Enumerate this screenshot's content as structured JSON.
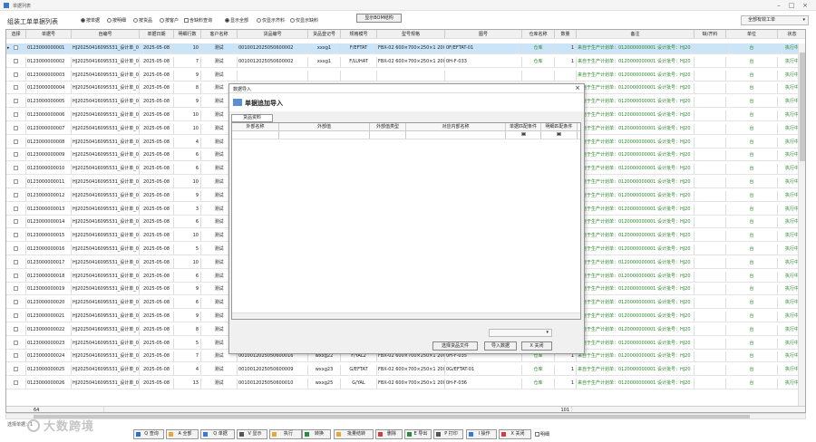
{
  "window": {
    "title": "单据列表"
  },
  "header": {
    "title": "组装工单单据列表",
    "view_options": [
      {
        "label": "按单据",
        "on": true
      },
      {
        "label": "按明细",
        "on": false
      },
      {
        "label": "按货品",
        "on": false
      },
      {
        "label": "按客户",
        "on": false
      }
    ],
    "material_query": "含缺料查询",
    "display_options": [
      {
        "label": "显示全部",
        "on": true
      },
      {
        "label": "仅显示齐料",
        "on": false
      },
      {
        "label": "仅显示缺料",
        "on": false
      }
    ],
    "bom_button": "显示BOM结构",
    "filter_dropdown": "全部有效工单"
  },
  "grid": {
    "columns": [
      "选择",
      "单据号",
      "自编号",
      "单据日期",
      "明细行数",
      "客户名称",
      "货品编号",
      "货品登记号",
      "规格模号",
      "型号规格",
      "图号",
      "仓库名称",
      "数量",
      "备注",
      "缺/齐料",
      "单位",
      "状态"
    ],
    "rows": [
      {
        "id": "0123000000001",
        "code": "HJ20250416095531_设计单_001",
        "date": "2025-05-08",
        "lines": "10",
        "cust": "测试",
        "prod": "0010012025050600002",
        "reg": "xxxg1",
        "mold": "F/EFTAT",
        "spec": "FBX-02 600×700×250×1 200",
        "drawing": "0F/EFTAT-01",
        "wh": "仓库",
        "qty": "1",
        "note": "来自于生产计划单：0120000000001 设计批号：HJ20",
        "shortage": "",
        "unit": "台",
        "status": "执行中"
      },
      {
        "id": "0123000000002",
        "code": "HJ20250416095531_设计单_001",
        "date": "2025-05-08",
        "lines": "7",
        "cust": "测试",
        "prod": "0010012025050600002",
        "reg": "xxxg1",
        "mold": "F/LUHAT",
        "spec": "FBX-02 600×700×250×1 200",
        "drawing": "0H-F-033",
        "wh": "仓库",
        "qty": "1",
        "note": "来自于生产计划单：0120000000001 设计批号：HJ20",
        "shortage": "",
        "unit": "台",
        "status": "执行中"
      },
      {
        "id": "0123000000003",
        "code": "HJ20250416095531_设计单_001",
        "date": "2025-05-08",
        "lines": "9",
        "cust": "测试",
        "prod": "",
        "reg": "",
        "mold": "",
        "spec": "",
        "drawing": "",
        "wh": "",
        "qty": "",
        "note": "来自于生产计划单：0120000000001 设计批号：HJ20",
        "shortage": "",
        "unit": "台",
        "status": "执行中"
      },
      {
        "id": "0123000000004",
        "code": "HJ20250416095531_设计单_001",
        "date": "2025-05-08",
        "lines": "8",
        "cust": "测试",
        "prod": "",
        "reg": "",
        "mold": "",
        "spec": "",
        "drawing": "",
        "wh": "",
        "qty": "",
        "note": "来自于生产计划单：0120000000001 设计批号：HJ20",
        "shortage": "",
        "unit": "台",
        "status": "执行中"
      },
      {
        "id": "0123000000005",
        "code": "HJ20250416095531_设计单_001",
        "date": "2025-05-08",
        "lines": "9",
        "cust": "测试",
        "prod": "",
        "reg": "",
        "mold": "",
        "spec": "",
        "drawing": "",
        "wh": "",
        "qty": "",
        "note": "来自于生产计划单：0120000000001 设计批号：HJ20",
        "shortage": "",
        "unit": "台",
        "status": "执行中"
      },
      {
        "id": "0123000000006",
        "code": "HJ20250416095531_设计单_001",
        "date": "2025-05-08",
        "lines": "10",
        "cust": "测试",
        "prod": "",
        "reg": "",
        "mold": "",
        "spec": "",
        "drawing": "",
        "wh": "",
        "qty": "",
        "note": "来自于生产计划单：0120000000001 设计批号：HJ20",
        "shortage": "",
        "unit": "台",
        "status": "执行中"
      },
      {
        "id": "0123000000007",
        "code": "HJ20250416095531_设计单_001",
        "date": "2025-05-08",
        "lines": "10",
        "cust": "测试",
        "prod": "",
        "reg": "",
        "mold": "",
        "spec": "",
        "drawing": "",
        "wh": "",
        "qty": "",
        "note": "来自于生产计划单：0120000000001 设计批号：HJ20",
        "shortage": "",
        "unit": "台",
        "status": "执行中"
      },
      {
        "id": "0123000000008",
        "code": "HJ20250416095531_设计单_001",
        "date": "2025-05-08",
        "lines": "4",
        "cust": "测试",
        "prod": "",
        "reg": "",
        "mold": "",
        "spec": "",
        "drawing": "",
        "wh": "",
        "qty": "",
        "note": "来自于生产计划单：0120000000001 设计批号：HJ20",
        "shortage": "",
        "unit": "台",
        "status": "执行中"
      },
      {
        "id": "0123000000009",
        "code": "HJ20250416095531_设计单_001",
        "date": "2025-05-08",
        "lines": "6",
        "cust": "测试",
        "prod": "",
        "reg": "",
        "mold": "",
        "spec": "",
        "drawing": "",
        "wh": "",
        "qty": "",
        "note": "来自于生产计划单：0120000000001 设计批号：HJ20",
        "shortage": "",
        "unit": "台",
        "status": "执行中"
      },
      {
        "id": "0123000000010",
        "code": "HJ20250416095531_设计单_001",
        "date": "2025-05-08",
        "lines": "6",
        "cust": "测试",
        "prod": "",
        "reg": "",
        "mold": "",
        "spec": "",
        "drawing": "",
        "wh": "",
        "qty": "",
        "note": "来自于生产计划单：0120000000001 设计批号：HJ20",
        "shortage": "",
        "unit": "台",
        "status": "执行中"
      },
      {
        "id": "0123000000011",
        "code": "HJ20250416095531_设计单_001",
        "date": "2025-05-08",
        "lines": "10",
        "cust": "测试",
        "prod": "",
        "reg": "",
        "mold": "",
        "spec": "",
        "drawing": "",
        "wh": "",
        "qty": "",
        "note": "来自于生产计划单：0120000000001 设计批号：HJ20",
        "shortage": "",
        "unit": "台",
        "status": "执行中"
      },
      {
        "id": "0123000000012",
        "code": "HJ20250416095531_设计单_001",
        "date": "2025-05-08",
        "lines": "9",
        "cust": "测试",
        "prod": "",
        "reg": "",
        "mold": "",
        "spec": "",
        "drawing": "",
        "wh": "",
        "qty": "",
        "note": "来自于生产计划单：0120000000001 设计批号：HJ20",
        "shortage": "",
        "unit": "台",
        "status": "执行中"
      },
      {
        "id": "0123000000013",
        "code": "HJ20250416095531_设计单_001",
        "date": "2025-05-08",
        "lines": "3",
        "cust": "测试",
        "prod": "",
        "reg": "",
        "mold": "",
        "spec": "",
        "drawing": "",
        "wh": "",
        "qty": "",
        "note": "来自于生产计划单：0120000000001 设计批号：HJ20",
        "shortage": "",
        "unit": "台",
        "status": "执行中"
      },
      {
        "id": "0123000000014",
        "code": "HJ20250416095531_设计单_001",
        "date": "2025-05-08",
        "lines": "6",
        "cust": "测试",
        "prod": "",
        "reg": "",
        "mold": "",
        "spec": "",
        "drawing": "",
        "wh": "",
        "qty": "",
        "note": "来自于生产计划单：0120000000001 设计批号：HJ20",
        "shortage": "",
        "unit": "台",
        "status": "执行中"
      },
      {
        "id": "0123000000015",
        "code": "HJ20250416095531_设计单_001",
        "date": "2025-05-08",
        "lines": "10",
        "cust": "测试",
        "prod": "",
        "reg": "",
        "mold": "",
        "spec": "",
        "drawing": "",
        "wh": "",
        "qty": "",
        "note": "来自于生产计划单：0120000000001 设计批号：HJ20",
        "shortage": "",
        "unit": "台",
        "status": "执行中"
      },
      {
        "id": "0123000000016",
        "code": "HJ20250416095531_设计单_001",
        "date": "2025-05-08",
        "lines": "5",
        "cust": "测试",
        "prod": "",
        "reg": "",
        "mold": "",
        "spec": "",
        "drawing": "",
        "wh": "",
        "qty": "",
        "note": "来自于生产计划单：0120000000001 设计批号：HJ20",
        "shortage": "",
        "unit": "台",
        "status": "执行中"
      },
      {
        "id": "0123000000017",
        "code": "HJ20250416095531_设计单_001",
        "date": "2025-05-08",
        "lines": "10",
        "cust": "测试",
        "prod": "",
        "reg": "",
        "mold": "",
        "spec": "",
        "drawing": "",
        "wh": "",
        "qty": "",
        "note": "来自于生产计划单：0120000000001 设计批号：HJ20",
        "shortage": "",
        "unit": "台",
        "status": "执行中"
      },
      {
        "id": "0123000000018",
        "code": "HJ20250416095531_设计单_001",
        "date": "2025-05-08",
        "lines": "6",
        "cust": "测试",
        "prod": "",
        "reg": "",
        "mold": "",
        "spec": "",
        "drawing": "",
        "wh": "",
        "qty": "",
        "note": "来自于生产计划单：0120000000001 设计批号：HJ20",
        "shortage": "",
        "unit": "台",
        "status": "执行中"
      },
      {
        "id": "0123000000019",
        "code": "HJ20250416095531_设计单_001",
        "date": "2025-05-08",
        "lines": "9",
        "cust": "测试",
        "prod": "",
        "reg": "",
        "mold": "",
        "spec": "",
        "drawing": "",
        "wh": "",
        "qty": "",
        "note": "来自于生产计划单：0120000000001 设计批号：HJ20",
        "shortage": "",
        "unit": "台",
        "status": "执行中"
      },
      {
        "id": "0123000000020",
        "code": "HJ20250416095531_设计单_001",
        "date": "2025-05-08",
        "lines": "6",
        "cust": "测试",
        "prod": "",
        "reg": "",
        "mold": "",
        "spec": "",
        "drawing": "",
        "wh": "",
        "qty": "",
        "note": "来自于生产计划单：0120000000001 设计批号：HJ20",
        "shortage": "",
        "unit": "台",
        "status": "执行中"
      },
      {
        "id": "0123000000021",
        "code": "HJ20250416095531_设计单_001",
        "date": "2025-05-08",
        "lines": "9",
        "cust": "测试",
        "prod": "",
        "reg": "",
        "mold": "",
        "spec": "",
        "drawing": "",
        "wh": "",
        "qty": "",
        "note": "来自于生产计划单：0120000000001 设计批号：HJ20",
        "shortage": "",
        "unit": "台",
        "status": "执行中"
      },
      {
        "id": "0123000000022",
        "code": "HJ20250416095531_设计单_001",
        "date": "2025-05-08",
        "lines": "8",
        "cust": "测试",
        "prod": "",
        "reg": "",
        "mold": "",
        "spec": "",
        "drawing": "",
        "wh": "",
        "qty": "",
        "note": "来自于生产计划单：0120000000001 设计批号：HJ20",
        "shortage": "",
        "unit": "台",
        "status": "执行中"
      },
      {
        "id": "0123000000023",
        "code": "HJ20250416095531_设计单_001",
        "date": "2025-05-08",
        "lines": "5",
        "cust": "测试",
        "prod": "",
        "reg": "",
        "mold": "",
        "spec": "",
        "drawing": "",
        "wh": "",
        "qty": "",
        "note": "来自于生产计划单：0120000000001 设计批号：HJ20",
        "shortage": "",
        "unit": "台",
        "status": "执行中"
      },
      {
        "id": "0123000000024",
        "code": "HJ20250416095531_设计单_001",
        "date": "2025-05-08",
        "lines": "7",
        "cust": "测试",
        "prod": "0010012025050600016",
        "reg": "wxxg22",
        "mold": "F/YAL2",
        "spec": "FBX-02 600×700×250×1 200",
        "drawing": "0H-F-035",
        "wh": "仓库",
        "qty": "1",
        "note": "来自于生产计划单：0120000000001 设计批号：HJ20",
        "shortage": "",
        "unit": "台",
        "status": "执行中"
      },
      {
        "id": "0123000000025",
        "code": "HJ20250416095531_设计单_001",
        "date": "2025-05-08",
        "lines": "4",
        "cust": "测试",
        "prod": "0010012025050600009",
        "reg": "wxxg23",
        "mold": "G/EFTAT",
        "spec": "FBX-02 600×700×250×1 200",
        "drawing": "0G/EFTAT-01",
        "wh": "仓库",
        "qty": "1",
        "note": "来自于生产计划单：0120000000001 设计批号：HJ20",
        "shortage": "",
        "unit": "台",
        "status": "执行中"
      },
      {
        "id": "0123000000026",
        "code": "HJ20250416095531_设计单_001",
        "date": "2025-05-08",
        "lines": "13",
        "cust": "测试",
        "prod": "0010012025050600010",
        "reg": "wxxg25",
        "mold": "G/YAL",
        "spec": "FBX-02 600×700×250×1 200",
        "drawing": "0H-F-036",
        "wh": "仓库",
        "qty": "1",
        "note": "来自于生产计划单：0120000000001 设计批号：HJ20",
        "shortage": "",
        "unit": "台",
        "status": "执行中"
      }
    ],
    "footer_count": "64",
    "footer_qty": "101"
  },
  "status": {
    "text": "选择单据：1"
  },
  "toolbar": [
    {
      "label": "Q 查询",
      "color": "#2b6fd1"
    },
    {
      "label": "A 全部",
      "color": "#e8a53a"
    },
    {
      "label": "Q 单据",
      "color": "#3a7ad6"
    },
    {
      "label": "V 显示",
      "color": "#555555"
    },
    {
      "label": "执行",
      "color": "#e8a53a"
    },
    {
      "label": "转换",
      "color": "#2b8a3e"
    },
    {
      "label": "批量结转",
      "color": "#e8a53a"
    },
    {
      "label": "删除",
      "color": "#d63a3a"
    },
    {
      "label": "E 导出",
      "color": "#2b8a3e"
    },
    {
      "label": "P 打印",
      "color": "#555555"
    },
    {
      "label": "I 操作",
      "color": "#3a7ad6"
    },
    {
      "label": "X 关闭",
      "color": "#d63a3a"
    }
  ],
  "toolbar_check": "明细",
  "watermark": "大数跨境",
  "dialog": {
    "title": "数据导入",
    "heading": "单据追加导入",
    "tab": "货品资料",
    "columns": [
      "外部名称",
      "外部值",
      "外部值类型",
      "对应内部名称",
      "单据匹配条件",
      "明细匹配条件"
    ],
    "buttons": [
      "选择货品文件",
      "导入数据",
      "X 关闭"
    ]
  }
}
